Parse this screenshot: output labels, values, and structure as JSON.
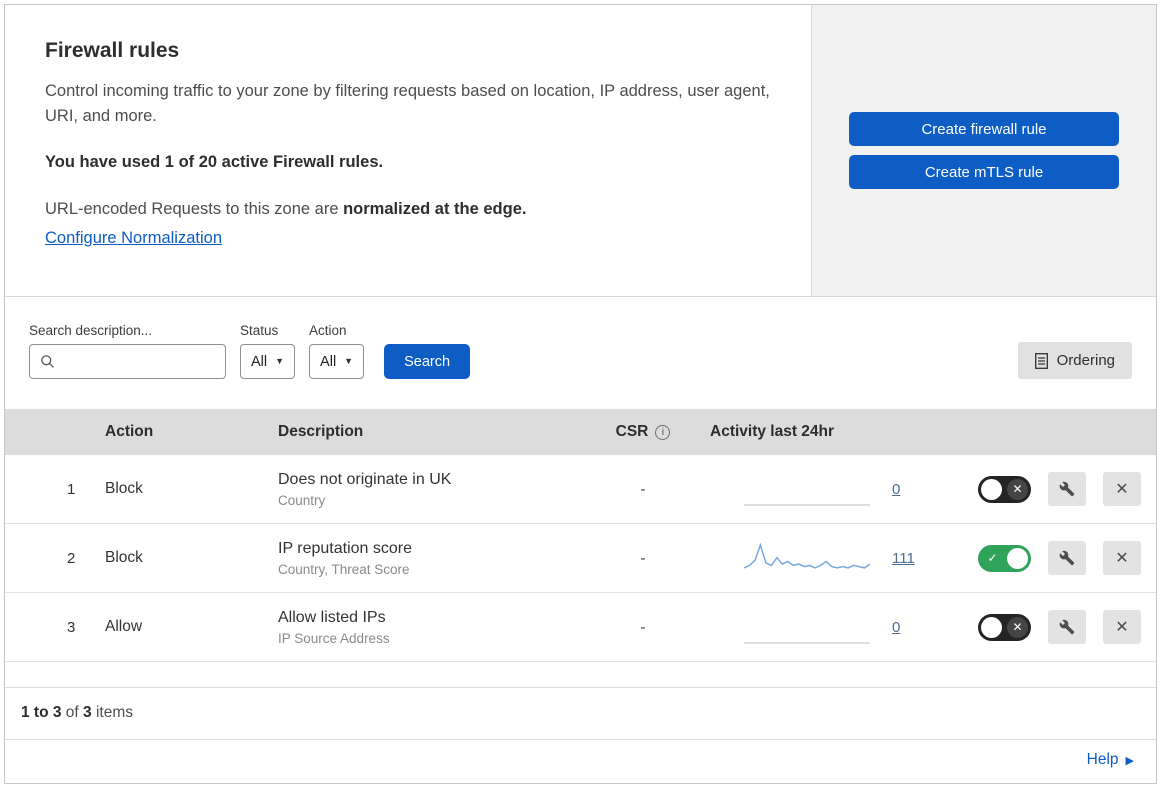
{
  "colors": {
    "accent_blue": "#0d5dc5",
    "toggle_green": "#30a35a",
    "toggle_off": "#242424",
    "sparkline_blue": "#76a9dd",
    "sparkline_flat": "#d6d6d6"
  },
  "icons": {
    "caret_down": "▼",
    "info": "i",
    "check": "✓",
    "cross": "✕",
    "help_arrow": "▶"
  },
  "header": {
    "title": "Firewall rules",
    "description": "Control incoming traffic to your zone by filtering requests based on location, IP address, user agent, URI, and more.",
    "usage_line": "You have used 1 of 20 active Firewall rules.",
    "normalization_prefix": "URL-encoded Requests to this zone are ",
    "normalization_bold": "normalized at the edge.",
    "normalization_link": "Configure Normalization",
    "create_firewall_button": "Create firewall rule",
    "create_mtls_button": "Create mTLS rule"
  },
  "filters": {
    "search_label": "Search description...",
    "search_value": "",
    "status_label": "Status",
    "status_value": "All",
    "action_label": "Action",
    "action_value": "All",
    "search_button": "Search",
    "ordering_button": "Ordering"
  },
  "table": {
    "headers": {
      "action": "Action",
      "description": "Description",
      "csr": "CSR",
      "activity": "Activity last 24hr"
    },
    "rows": [
      {
        "num": "1",
        "action": "Block",
        "description": "Does not originate in UK",
        "subtitle": "Country",
        "csr": "-",
        "activity_count": "0",
        "enabled": false,
        "sparkline": []
      },
      {
        "num": "2",
        "action": "Block",
        "description": "IP reputation score",
        "subtitle": "Country, Threat Score",
        "csr": "-",
        "activity_count": "111",
        "enabled": true,
        "sparkline": [
          4,
          6,
          10,
          22,
          8,
          6,
          12,
          7,
          9,
          6,
          7,
          5,
          6,
          4,
          6,
          9,
          5,
          4,
          5,
          4,
          6,
          5,
          4,
          7
        ]
      },
      {
        "num": "3",
        "action": "Allow",
        "description": "Allow listed IPs",
        "subtitle": "IP Source Address",
        "csr": "-",
        "activity_count": "0",
        "enabled": false,
        "sparkline": []
      }
    ]
  },
  "footer": {
    "range": "1 to 3",
    "of": " of ",
    "total": "3",
    "items": " items"
  },
  "help": {
    "label": "Help"
  }
}
